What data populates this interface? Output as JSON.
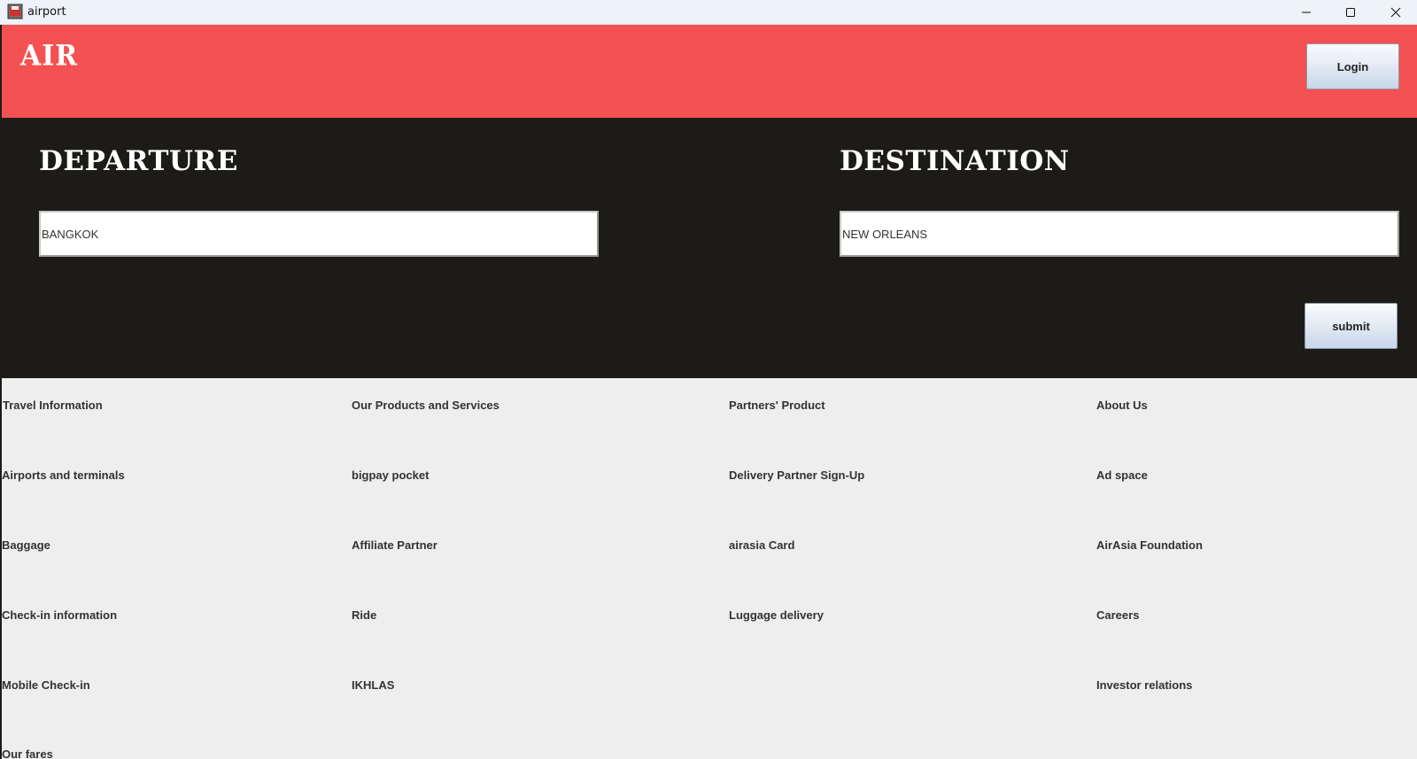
{
  "window": {
    "title": "airport"
  },
  "header": {
    "brand": "AIR",
    "login_label": "Login"
  },
  "search": {
    "departure_title": "DEPARTURE",
    "departure_value": "BANGKOK",
    "destination_title": "DESTINATION",
    "destination_value": "NEW ORLEANS",
    "submit_label": "submit"
  },
  "links": {
    "travel": {
      "heading": "Travel Information",
      "items": [
        "Airports and terminals",
        "Baggage",
        "Check-in information",
        "Mobile Check-in",
        "Our fares"
      ]
    },
    "products": {
      "heading": "Our Products and Services",
      "items": [
        "bigpay pocket",
        "Affiliate Partner",
        "Ride",
        "IKHLAS"
      ]
    },
    "partners": {
      "heading": "Partners' Product",
      "items": [
        "Delivery Partner Sign-Up",
        "airasia Card",
        "Luggage delivery"
      ]
    },
    "about": {
      "heading": "About Us",
      "items": [
        "Ad space",
        "AirAsia Foundation",
        "Careers",
        "Investor relations"
      ]
    }
  },
  "colors": {
    "header_bg": "#f45152",
    "panel_bg": "#1d1b17",
    "page_bg": "#eeeeee"
  },
  "icons": {
    "app": "airport-app-icon",
    "minimize": "minimize-icon",
    "maximize": "maximize-icon",
    "close": "close-icon"
  }
}
